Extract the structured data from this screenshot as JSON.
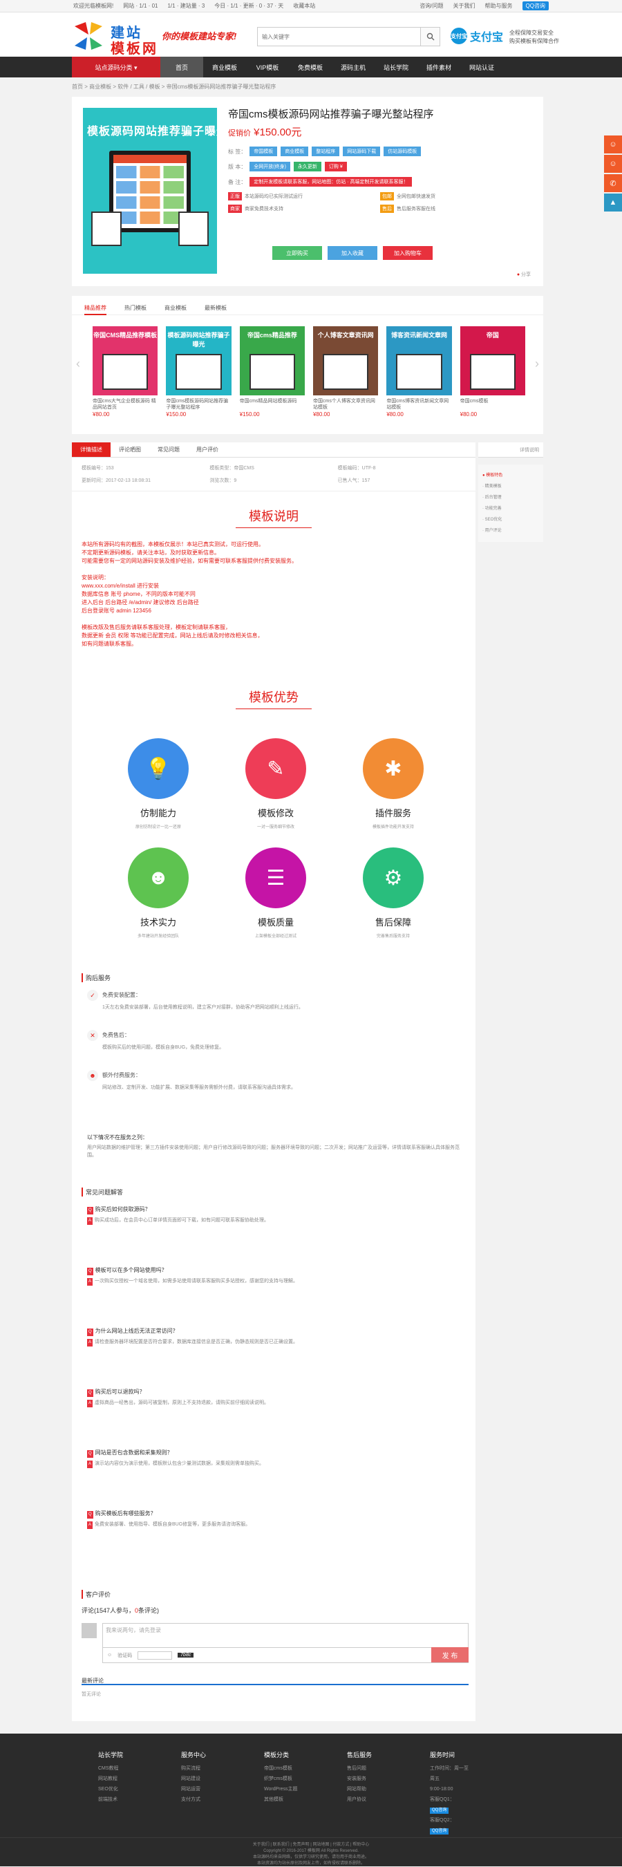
{
  "topbar": {
    "welcome": "欢迎光临模板网!",
    "user": "网站 · 1/1 · 01",
    "today": "1/1 · 建站量 · 3",
    "time": "今日 · 1/1 · 更新 · 0 · 37 · 天",
    "fav": "收藏本站",
    "top_links": [
      "网站地图",
      "网站地图"
    ],
    "qq": "QQ咨询",
    "right": [
      "咨询/问题",
      "关于我们",
      "帮助与服务"
    ]
  },
  "header": {
    "logo_line1": "建站",
    "logo_line2": "模板网",
    "slogan": "你的模板建站专家!",
    "search_placeholder": "输入关键字",
    "alipay": "支付宝",
    "alipay_label": "支付宝",
    "alipay_note1": "全程保障交易安全",
    "alipay_note2": "购买模板有保障合作"
  },
  "nav": [
    "站点源码分类 ▾",
    "首页",
    "商业模板",
    "VIP模板",
    "免费模板",
    "源码主机",
    "站长学院",
    "插件素材",
    "网站认证"
  ],
  "breadcrumb": "首页 > 商业模板 > 软件 / 工具 / 模板 > 帝国cms模板源码网站推荐骗子曝光整站程序",
  "product": {
    "img_title": "模板源码网站推荐骗子曝光",
    "title": "帝国cms模板源码网站推荐骗子曝光整站程序",
    "price_label": "促销价",
    "price": "¥150.00元",
    "row1_label": "标 签：",
    "tags": [
      "帝国模板",
      "商业模板",
      "整站程序",
      "网站源码下载",
      "仿站源码模板"
    ],
    "row2_label": "版 本：",
    "versions": [
      "全网开放(终身)",
      "永久更新",
      "订购 ¥"
    ],
    "row3_label": "备 注：",
    "notice": "定制开发模板请联系客服，网站地图：仿站 · 高端定制开发请联系客服！",
    "info": [
      [
        "正版",
        "本站源码均已实际测试运行"
      ],
      [
        "包邮",
        "全网包邮快速发货"
      ],
      [
        "商家",
        "商家免费技术支持"
      ],
      [
        "售后",
        "售后服务客服在线"
      ]
    ],
    "buttons": [
      "立即购买",
      "加入收藏",
      "加入购物车"
    ],
    "share": "分享"
  },
  "related": {
    "tabs": [
      "精品推荐",
      "热门模板",
      "商业模板",
      "最新模板"
    ],
    "items": [
      {
        "title": "帝国CMS精品推荐模板",
        "desc": "帝国cms大气企业模板源码 精品网站首页",
        "price": "¥80.00",
        "bg": "#e2336b"
      },
      {
        "title": "模板源码网站推荐骗子曝光",
        "desc": "帝国cms模板源码网站推荐骗子曝光整站程序",
        "price": "¥150.00",
        "bg": "#24b5c6"
      },
      {
        "title": "帝国cms精品推荐",
        "desc": "帝国cms精品网站模板源码",
        "price": "¥150.00",
        "bg": "#39a84a"
      },
      {
        "title": "个人博客文章资讯网",
        "desc": "帝国cms个人博客文章资讯网站模板",
        "price": "¥80.00",
        "bg": "#7a4a34"
      },
      {
        "title": "博客资讯新闻文章网",
        "desc": "帝国cms博客资讯新闻文章网站模板",
        "price": "¥80.00",
        "bg": "#2c98c4"
      },
      {
        "title": "帝国",
        "desc": "帝国cms模板",
        "price": "¥80.00",
        "bg": "#d3184b"
      }
    ]
  },
  "detail": {
    "tabs": [
      "详情描述",
      "评论晒图",
      "常见问题",
      "用户评价"
    ],
    "meta": [
      [
        "模板编号：",
        "153"
      ],
      [
        "模板类型：",
        "帝国CMS"
      ],
      [
        "模板编码：",
        "UTF-8"
      ],
      [
        "更新时间：",
        "2017-02-13 18:08:31"
      ],
      [
        "浏览次数：",
        "9"
      ],
      [
        "已售人气：",
        "157"
      ]
    ],
    "title": "模板说明",
    "notes": [
      "本站所有源码均有的截图，本模板仅展示！本站已真实测试，可运行使用。",
      "不定期更新源码模板，请关注本站，及时获取更新信息。",
      "可能需要您有一定的网站源码安装及维护经验，如有需要可联系客服提供付费安装服务。",
      "",
      "安装说明：",
      "www.xxx.com/e/install 进行安装",
      "数据库信息 账号 phome，不同的版本可能不同",
      "进入后台 后台路径 /e/admin/ 建议修改 后台路径",
      "后台登录账号 admin 123456",
      "",
      "模板改版及售后服务请联系客服处理，模板定制请联系客服，",
      "数据更新 会员 权限 等功能已配置完成，网站上线后请及时修改相关信息，",
      "如有问题请联系客服。"
    ],
    "adv_title": "模板优势",
    "features": [
      {
        "name": "仿制能力",
        "desc": "原创仿制设计一比一还原",
        "color": "#3d8de8",
        "icon": "💡"
      },
      {
        "name": "模板修改",
        "desc": "一对一服务细节修改",
        "color": "#ee3d57",
        "icon": "✎"
      },
      {
        "name": "插件服务",
        "desc": "模板插件功能开发支持",
        "color": "#f28c34",
        "icon": "✱"
      },
      {
        "name": "技术实力",
        "desc": "多年建站开发经验团队",
        "color": "#5ec350",
        "icon": "☻"
      },
      {
        "name": "模板质量",
        "desc": "上架模板全部经过测试",
        "color": "#c514a6",
        "icon": "☰"
      },
      {
        "name": "售后保障",
        "desc": "完善售后服务支持",
        "color": "#29be7d",
        "icon": "⚙"
      }
    ],
    "service_title": "购后服务",
    "services": [
      {
        "name": "免费安装配置：",
        "text": "1天左右免费安装部署，后台使用教程说明，建立客户对接群，协助客户把网站顺利上线运行。",
        "icon": "✓"
      },
      {
        "name": "免费售后：",
        "text": "模板购买后的使用问题，模板自身BUG，免费处理修复。",
        "icon": "✕"
      },
      {
        "name": "额外付费服务：",
        "text": "网站修改、定制开发、功能扩展、数据采集等服务需额外付费，请联系客服沟通具体需求。",
        "icon": "☻"
      }
    ],
    "disclaimer_title": "以下情况不在服务之列：",
    "disclaimer": "用户网站数据的维护管理；第三方插件安装使用问题；用户自行修改源码导致的问题；服务器环境导致的问题；二次开发；网站推广及运营等，详情请联系客服确认具体服务范围。",
    "faq_title": "常见问题解答",
    "faq": [
      {
        "q": "购买后如何获取源码？",
        "a": "购买成功后，在会员中心订单详情页面即可下载，如有问题可联系客服协助处理。"
      },
      {
        "q": "模板可以在多个网站使用吗？",
        "a": "一次购买仅授权一个域名使用，如需多站使用请联系客服购买多站授权，感谢您的支持与理解。"
      },
      {
        "q": "为什么网站上线后无法正常访问？",
        "a": "请检查服务器环境配置是否符合要求，数据库连接信息是否正确，伪静态规则是否已正确设置。"
      },
      {
        "q": "购买后可以退款吗？",
        "a": "虚拟商品一经售出，源码可被复制，原则上不支持退款，请购买前仔细阅读说明。"
      },
      {
        "q": "网站是否包含数据和采集规则？",
        "a": "演示站内容仅为演示使用，模板默认包含少量测试数据，采集规则需单独购买。"
      },
      {
        "q": "购买模板后有哪些服务？",
        "a": "免费安装部署、使用指导、模板自身BUG修复等，更多服务请咨询客服。"
      }
    ],
    "comment_title": "客户评价",
    "comment_count": "评论(1547人参与，",
    "comment_num": "0",
    "comment_tail": "条评论)",
    "comment_placeholder": "我来说两句，请先登录",
    "captcha_label": "验证码",
    "captcha": "7b8c",
    "publish": "发 布",
    "latest": "最新评论",
    "latest_empty": "暂无评论"
  },
  "side": {
    "header": "详情说明",
    "title": "模板特色",
    "items": [
      "精美模板",
      "后台管理",
      "功能完善",
      "SEO优化",
      "用户评论"
    ]
  },
  "float": [
    {
      "icon": "☺",
      "color": "#f05a28"
    },
    {
      "icon": "☺",
      "color": "#f05a28"
    },
    {
      "icon": "✆",
      "color": "#f05a28"
    },
    {
      "icon": "▲",
      "color": "#2c98c4"
    }
  ],
  "footer": {
    "cols": [
      {
        "h": "站长学院",
        "items": [
          "CMS教程",
          "网站教程",
          "SEO优化",
          "前端技术"
        ]
      },
      {
        "h": "服务中心",
        "items": [
          "购买流程",
          "网站建设",
          "网站运营",
          "支付方式"
        ]
      },
      {
        "h": "模板分类",
        "items": [
          "帝国cms模板",
          "织梦cms模板",
          "WordPress主题",
          "其他模板"
        ]
      },
      {
        "h": "售后服务",
        "items": [
          "售后问题",
          "安装服务",
          "网站帮助",
          "用户协议"
        ]
      },
      {
        "h": "服务时间",
        "items": [
          "工作时间：周一至周五",
          "9:00-18:00",
          "客服QQ1：",
          "客服QQ2："
        ]
      }
    ],
    "qq": "QQ咨询",
    "bottom": [
      "关于我们 | 联系我们 | 免责声明 | 网站地图 | 付款方式 | 帮助中心",
      "Copyright © 2016-2017 模板网 All Rights Reserved.",
      "本站源码均来自网络，仅供学习研究使用，请勿用于商业用途。",
      "本站资源均为站长原创及网友上传，如有侵权请联系删除。"
    ]
  }
}
